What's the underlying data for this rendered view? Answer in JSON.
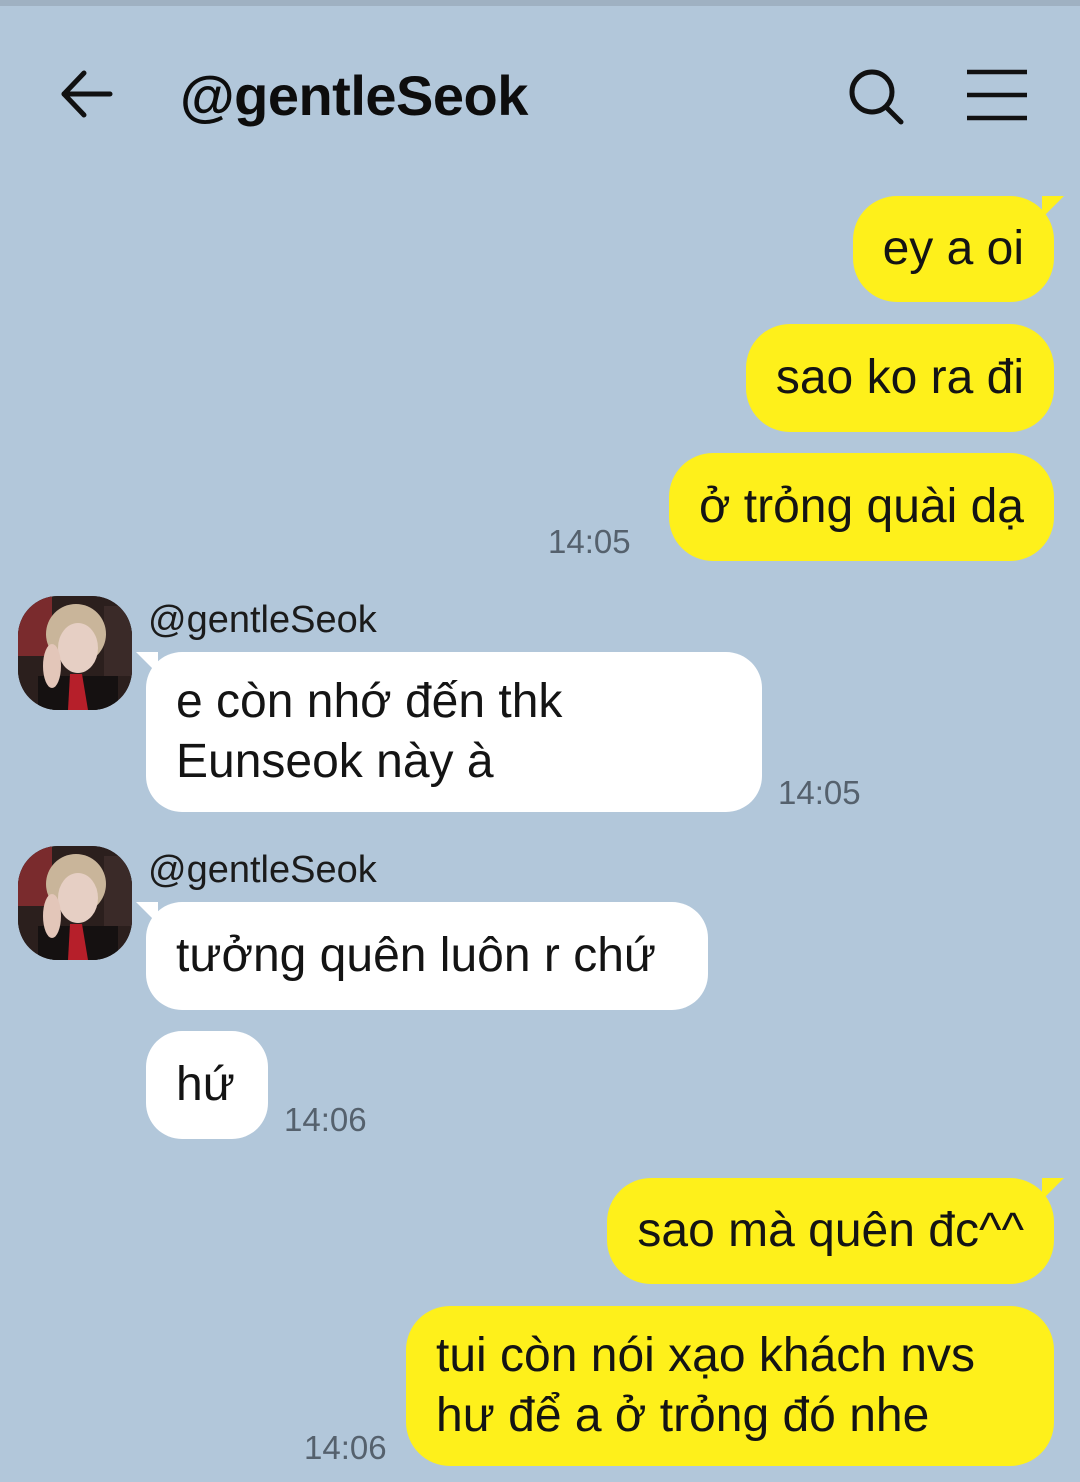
{
  "header": {
    "back_icon": "arrow-left-icon",
    "title": "@gentleSeok",
    "search_icon": "search-icon",
    "menu_icon": "hamburger-menu-icon"
  },
  "colors": {
    "background": "#b2c7da",
    "outgoing_bubble": "#fef01b",
    "incoming_bubble": "#ffffff",
    "timestamp": "#55616d"
  },
  "messages": [
    {
      "direction": "out",
      "text": "ey a oi"
    },
    {
      "direction": "out",
      "text": "sao ko ra đi"
    },
    {
      "direction": "out",
      "text": "ở trỏng quài dạ",
      "time": "14:05"
    },
    {
      "direction": "in",
      "sender": "@gentleSeok",
      "text_lines": [
        "e còn nhớ đến thk",
        "Eunseok này à"
      ],
      "time": "14:05"
    },
    {
      "direction": "in",
      "sender": "@gentleSeok",
      "text": "tưởng quên luôn r chứ"
    },
    {
      "direction": "in",
      "text": "hứ",
      "time": "14:06"
    },
    {
      "direction": "out",
      "text": "sao mà quên đc^^"
    },
    {
      "direction": "out",
      "text_lines": [
        "tui còn nói xạo khách nvs",
        "hư để a ở trỏng đó nhe"
      ],
      "time": "14:06"
    }
  ]
}
